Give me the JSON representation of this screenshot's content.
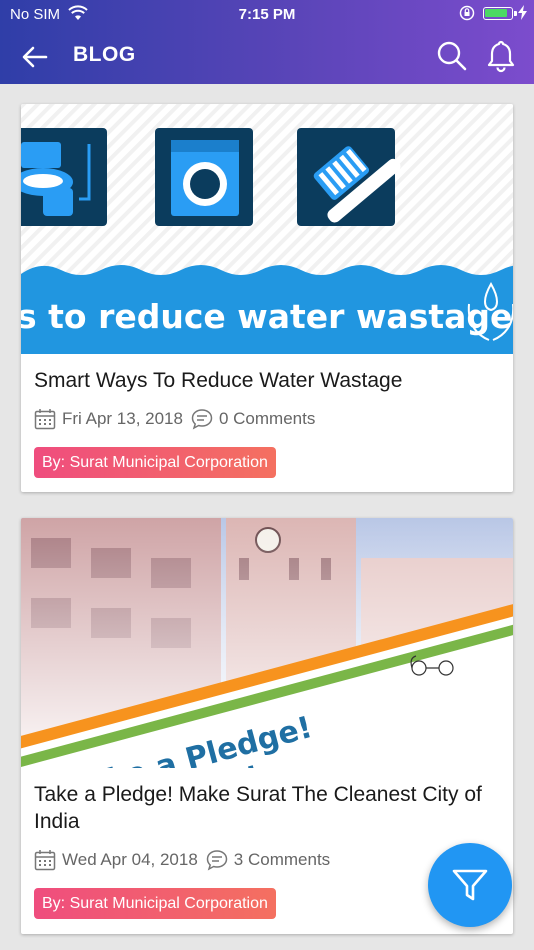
{
  "status_bar": {
    "carrier": "No SIM",
    "time": "7:15 PM",
    "battery_level": 0.9
  },
  "app_bar": {
    "title": "BLOG",
    "icons": [
      "back-arrow-icon",
      "search-icon",
      "bell-icon"
    ]
  },
  "posts": [
    {
      "image_text": "s to reduce water wastage",
      "title": "Smart Ways To Reduce Water Wastage",
      "date": "Fri Apr 13, 2018",
      "comments": "0 Comments",
      "author": "By: Surat Municipal Corporation"
    },
    {
      "image_text_line1": "Take a Pledge!",
      "image_text_line2": "Surat",
      "title": "Take a Pledge! Make Surat The Cleanest City of India",
      "date": "Wed Apr 04, 2018",
      "comments": "3 Comments",
      "author": "By: Surat Municipal Corporation"
    }
  ],
  "colors": {
    "header_start": "#2f3ea8",
    "header_end": "#7c4ccd",
    "fab": "#2196f3",
    "badge_start": "#ef4d7e",
    "badge_end": "#f47060",
    "water_blue": "#2196e0"
  }
}
